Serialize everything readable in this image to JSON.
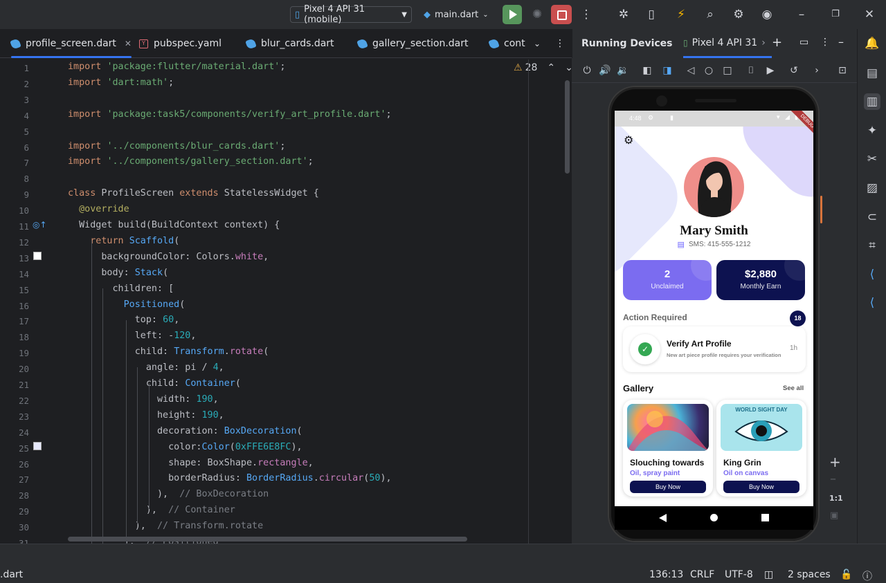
{
  "titlebar": {
    "device": "Pixel 4 API 31 (mobile)",
    "run_config": "main.dart"
  },
  "tabs": [
    {
      "label": "profile_screen.dart"
    },
    {
      "label": "pubspec.yaml"
    },
    {
      "label": "blur_cards.dart"
    },
    {
      "label": "gallery_section.dart"
    },
    {
      "label": "cont"
    }
  ],
  "editor": {
    "warnings": "28",
    "line_numbers": [
      "1",
      "2",
      "3",
      "4",
      "5",
      "6",
      "7",
      "8",
      "9",
      "10",
      "11",
      "12",
      "13",
      "14",
      "15",
      "16",
      "17",
      "18",
      "19",
      "20",
      "21",
      "22",
      "23",
      "24",
      "25",
      "26",
      "27",
      "28",
      "29",
      "30",
      "31"
    ],
    "code": [
      "import 'package:flutter/material.dart';",
      "import 'dart:math';",
      "",
      "import 'package:task5/components/verify_art_profile.dart';",
      "",
      "import '../components/blur_cards.dart';",
      "import '../components/gallery_section.dart';",
      "",
      "class ProfileScreen extends StatelessWidget {",
      "  @override",
      "  Widget build(BuildContext context) {",
      "    return Scaffold(",
      "      backgroundColor: Colors.white,",
      "      body: Stack(",
      "        children: [",
      "          Positioned(",
      "            top: 60,",
      "            left: -120,",
      "            child: Transform.rotate(",
      "              angle: pi / 4,",
      "              child: Container(",
      "                width: 190,",
      "                height: 190,",
      "                decoration: BoxDecoration(",
      "                  color:Color(0xFFE6E8FC),",
      "                  shape: BoxShape.rectangle,",
      "                  borderRadius: BorderRadius.circular(50),",
      "                ),  // BoxDecoration",
      "              ),  // Container",
      "            ),  // Transform.rotate",
      "          ),  // Positioned"
    ]
  },
  "running_devices": {
    "title": "Running Devices",
    "device_tab": "Pixel 4 API 31",
    "zoom_label": "1:1"
  },
  "app": {
    "status_time": "4:48",
    "debug_label": "DEBUG",
    "name": "Mary Smith",
    "sms": "SMS: 415-555-1212",
    "stats": [
      {
        "value": "2",
        "label": "Unclaimed",
        "color": "#7b6cf0"
      },
      {
        "value": "$2,880",
        "label": "Monthly Earn",
        "color": "#0d1250"
      }
    ],
    "action_title": "Action Required",
    "action_count": "18",
    "verify_title": "Verify Art Profile",
    "verify_sub": "New art piece profile requires your verification",
    "verify_time": "1h",
    "gallery_title": "Gallery",
    "see_all": "See all",
    "gallery": [
      {
        "title": "Slouching towards",
        "sub": "Oil, spray paint",
        "button": "Buy Now"
      },
      {
        "title": "King Grin",
        "sub": "Oil on canvas",
        "button": "Buy Now",
        "poster_text": "WORLD SIGHT DAY"
      }
    ]
  },
  "statusbar": {
    "file": ".dart",
    "position": "136:13",
    "line_ending": "CRLF",
    "encoding": "UTF-8",
    "indent": "2 spaces"
  },
  "colors": {
    "accent": "#3574f0",
    "run": "#57965c",
    "stop": "#c94f4f",
    "purple": "#7b6cf0",
    "navy": "#0d1250"
  }
}
